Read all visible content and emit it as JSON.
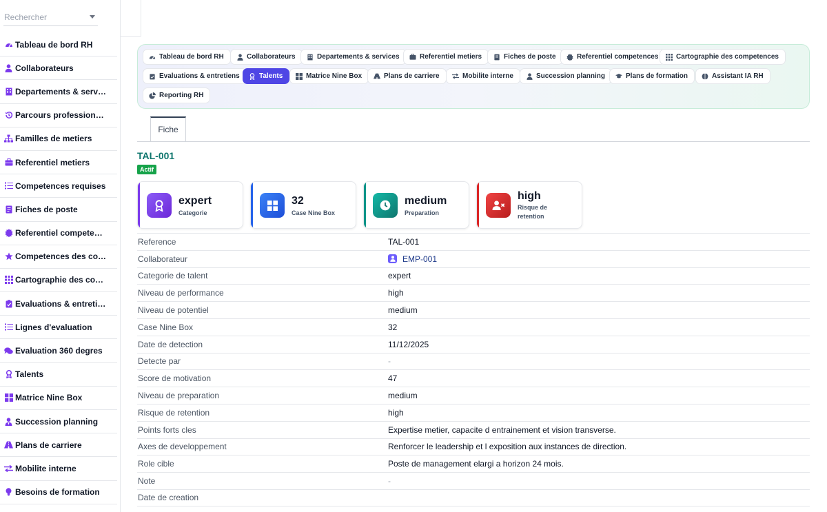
{
  "search": {
    "placeholder": "Rechercher"
  },
  "sidebar": {
    "items": [
      {
        "label": "Tableau de bord RH",
        "icon": "dashboard-icon"
      },
      {
        "label": "Collaborateurs",
        "icon": "user-icon"
      },
      {
        "label": "Departements & serv…",
        "icon": "building-icon"
      },
      {
        "label": "Parcours profession…",
        "icon": "history-icon"
      },
      {
        "label": "Familles de metiers",
        "icon": "sitemap-icon"
      },
      {
        "label": "Referentiel metiers",
        "icon": "briefcase-icon"
      },
      {
        "label": "Competences requises",
        "icon": "list-icon"
      },
      {
        "label": "Fiches de poste",
        "icon": "file-icon"
      },
      {
        "label": "Referentiel compete…",
        "icon": "certificate-icon"
      },
      {
        "label": "Competences des co…",
        "icon": "star-icon"
      },
      {
        "label": "Cartographie des co…",
        "icon": "grid-icon"
      },
      {
        "label": "Evaluations & entreti…",
        "icon": "clipboard-icon"
      },
      {
        "label": "Lignes d'evaluation",
        "icon": "list-icon"
      },
      {
        "label": "Evaluation 360 degres",
        "icon": "comments-icon"
      },
      {
        "label": "Talents",
        "icon": "award-icon"
      },
      {
        "label": "Matrice Nine Box",
        "icon": "grid-icon"
      },
      {
        "label": "Succession planning",
        "icon": "user-tie-icon"
      },
      {
        "label": "Plans de carriere",
        "icon": "road-icon"
      },
      {
        "label": "Mobilite interne",
        "icon": "arrows-icon"
      },
      {
        "label": "Besoins de formation",
        "icon": "lightbulb-icon"
      }
    ]
  },
  "tabs": [
    {
      "label": "Tableau de bord RH",
      "icon": "dashboard-icon"
    },
    {
      "label": "Collaborateurs",
      "icon": "user-icon"
    },
    {
      "label": "Departements & services",
      "icon": "building-icon"
    },
    {
      "label": "Referentiel metiers",
      "icon": "briefcase-icon"
    },
    {
      "label": "Fiches de poste",
      "icon": "file-icon"
    },
    {
      "label": "Referentiel competences",
      "icon": "certificate-icon"
    },
    {
      "label": "Cartographie des competences",
      "icon": "grid-icon"
    },
    {
      "label": "Evaluations & entretiens",
      "icon": "clipboard-icon"
    },
    {
      "label": "Talents",
      "icon": "award-icon",
      "active": true
    },
    {
      "label": "Matrice Nine Box",
      "icon": "grid-icon"
    },
    {
      "label": "Plans de carriere",
      "icon": "road-icon"
    },
    {
      "label": "Mobilite interne",
      "icon": "arrows-icon"
    },
    {
      "label": "Succession planning",
      "icon": "user-tie-icon"
    },
    {
      "label": "Plans de formation",
      "icon": "graduation-icon"
    },
    {
      "label": "Assistant IA RH",
      "icon": "brain-icon"
    },
    {
      "label": "Reporting RH",
      "icon": "pie-chart-icon"
    }
  ],
  "form": {
    "tab_label": "Fiche",
    "title": "TAL-001",
    "status": "Actif"
  },
  "kpis": [
    {
      "value": "expert",
      "caption": "Categorie",
      "color": "#7c3aed",
      "icon": "award-icon"
    },
    {
      "value": "32",
      "caption": "Case Nine Box",
      "color": "#2563eb",
      "icon": "grid-icon"
    },
    {
      "value": "medium",
      "caption": "Preparation",
      "color": "#0d9488",
      "icon": "clock-icon"
    },
    {
      "value": "high",
      "caption": "Risque de retention",
      "color": "#dc2626",
      "icon": "user-x-icon"
    }
  ],
  "details": [
    {
      "label": "Reference",
      "value": "TAL-001"
    },
    {
      "label": "Collaborateur",
      "value": "EMP-001"
    },
    {
      "label": "Categorie de talent",
      "value": "expert"
    },
    {
      "label": "Niveau de performance",
      "value": "high"
    },
    {
      "label": "Niveau de potentiel",
      "value": "medium"
    },
    {
      "label": "Case Nine Box",
      "value": "32"
    },
    {
      "label": "Date de detection",
      "value": "11/12/2025"
    },
    {
      "label": "Detecte par",
      "value": "-"
    },
    {
      "label": "Score de motivation",
      "value": "47"
    },
    {
      "label": "Niveau de preparation",
      "value": "medium"
    },
    {
      "label": "Risque de retention",
      "value": "high"
    },
    {
      "label": "Points forts cles",
      "value": "Expertise metier, capacite d entrainement et vision transverse."
    },
    {
      "label": "Axes de developpement",
      "value": "Renforcer le leadership et l exposition aux instances de direction."
    },
    {
      "label": "Role cible",
      "value": "Poste de management elargi a horizon 24 mois."
    },
    {
      "label": "Note",
      "value": "-"
    },
    {
      "label": "Date de creation",
      "value": ""
    }
  ]
}
